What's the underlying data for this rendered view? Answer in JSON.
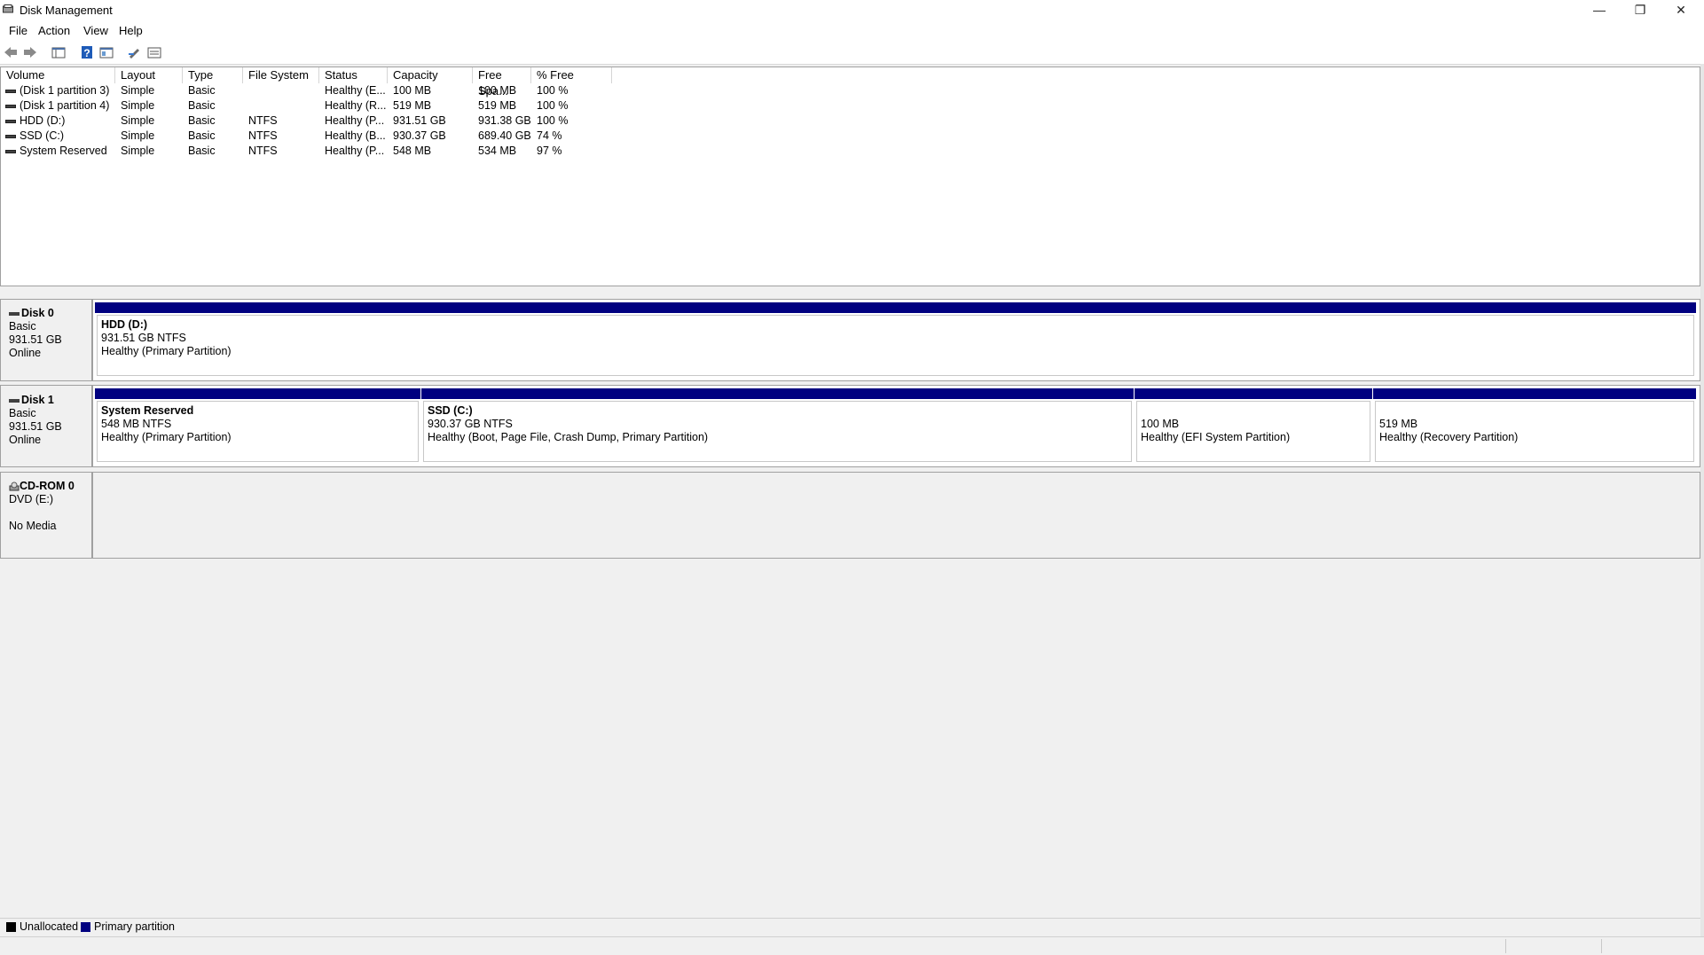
{
  "window": {
    "title": "Disk Management",
    "controls": {
      "minimize": "—",
      "restore": "❐",
      "close": "✕"
    }
  },
  "menu": [
    "File",
    "Action",
    "View",
    "Help"
  ],
  "toolbar": {
    "icons": [
      "back-icon",
      "forward-icon",
      "console-tree-icon",
      "help-icon",
      "properties-icon",
      "edit-icon",
      "list-view-icon"
    ]
  },
  "volume_table": {
    "columns": [
      "Volume",
      "Layout",
      "Type",
      "File System",
      "Status",
      "Capacity",
      "Free Spa...",
      "% Free"
    ],
    "rows": [
      [
        "(Disk 1 partition 3)",
        "Simple",
        "Basic",
        "",
        "Healthy (E...",
        "100 MB",
        "100 MB",
        "100 %"
      ],
      [
        "(Disk 1 partition 4)",
        "Simple",
        "Basic",
        "",
        "Healthy (R...",
        "519 MB",
        "519 MB",
        "100 %"
      ],
      [
        "HDD (D:)",
        "Simple",
        "Basic",
        "NTFS",
        "Healthy (P...",
        "931.51 GB",
        "931.38 GB",
        "100 %"
      ],
      [
        "SSD (C:)",
        "Simple",
        "Basic",
        "NTFS",
        "Healthy (B...",
        "930.37 GB",
        "689.40 GB",
        "74 %"
      ],
      [
        "System Reserved",
        "Simple",
        "Basic",
        "NTFS",
        "Healthy (P...",
        "548 MB",
        "534 MB",
        "97 %"
      ]
    ]
  },
  "disks": {
    "disk0": {
      "name": "Disk 0",
      "type": "Basic",
      "size": "931.51 GB",
      "status": "Online",
      "partitions": [
        {
          "name": "HDD  (D:)",
          "size": "931.51 GB NTFS",
          "status": "Healthy (Primary Partition)"
        }
      ]
    },
    "disk1": {
      "name": "Disk 1",
      "type": "Basic",
      "size": "931.51 GB",
      "status": "Online",
      "partitions": [
        {
          "name": "System Reserved",
          "size": "548 MB NTFS",
          "status": "Healthy (Primary Partition)"
        },
        {
          "name": "SSD  (C:)",
          "size": "930.37 GB NTFS",
          "status": "Healthy (Boot, Page File, Crash Dump, Primary Partition)"
        },
        {
          "name": "",
          "size": "100 MB",
          "status": "Healthy (EFI System Partition)"
        },
        {
          "name": "",
          "size": "519 MB",
          "status": "Healthy (Recovery Partition)"
        }
      ]
    },
    "cdrom0": {
      "name": "CD-ROM 0",
      "drive": "DVD (E:)",
      "status": "No Media"
    }
  },
  "legend": {
    "items": [
      {
        "label": "Unallocated",
        "color": "#000000"
      },
      {
        "label": "Primary partition",
        "color": "#000080"
      }
    ]
  },
  "colors": {
    "primary_partition": "#000080",
    "unallocated": "#000000"
  }
}
